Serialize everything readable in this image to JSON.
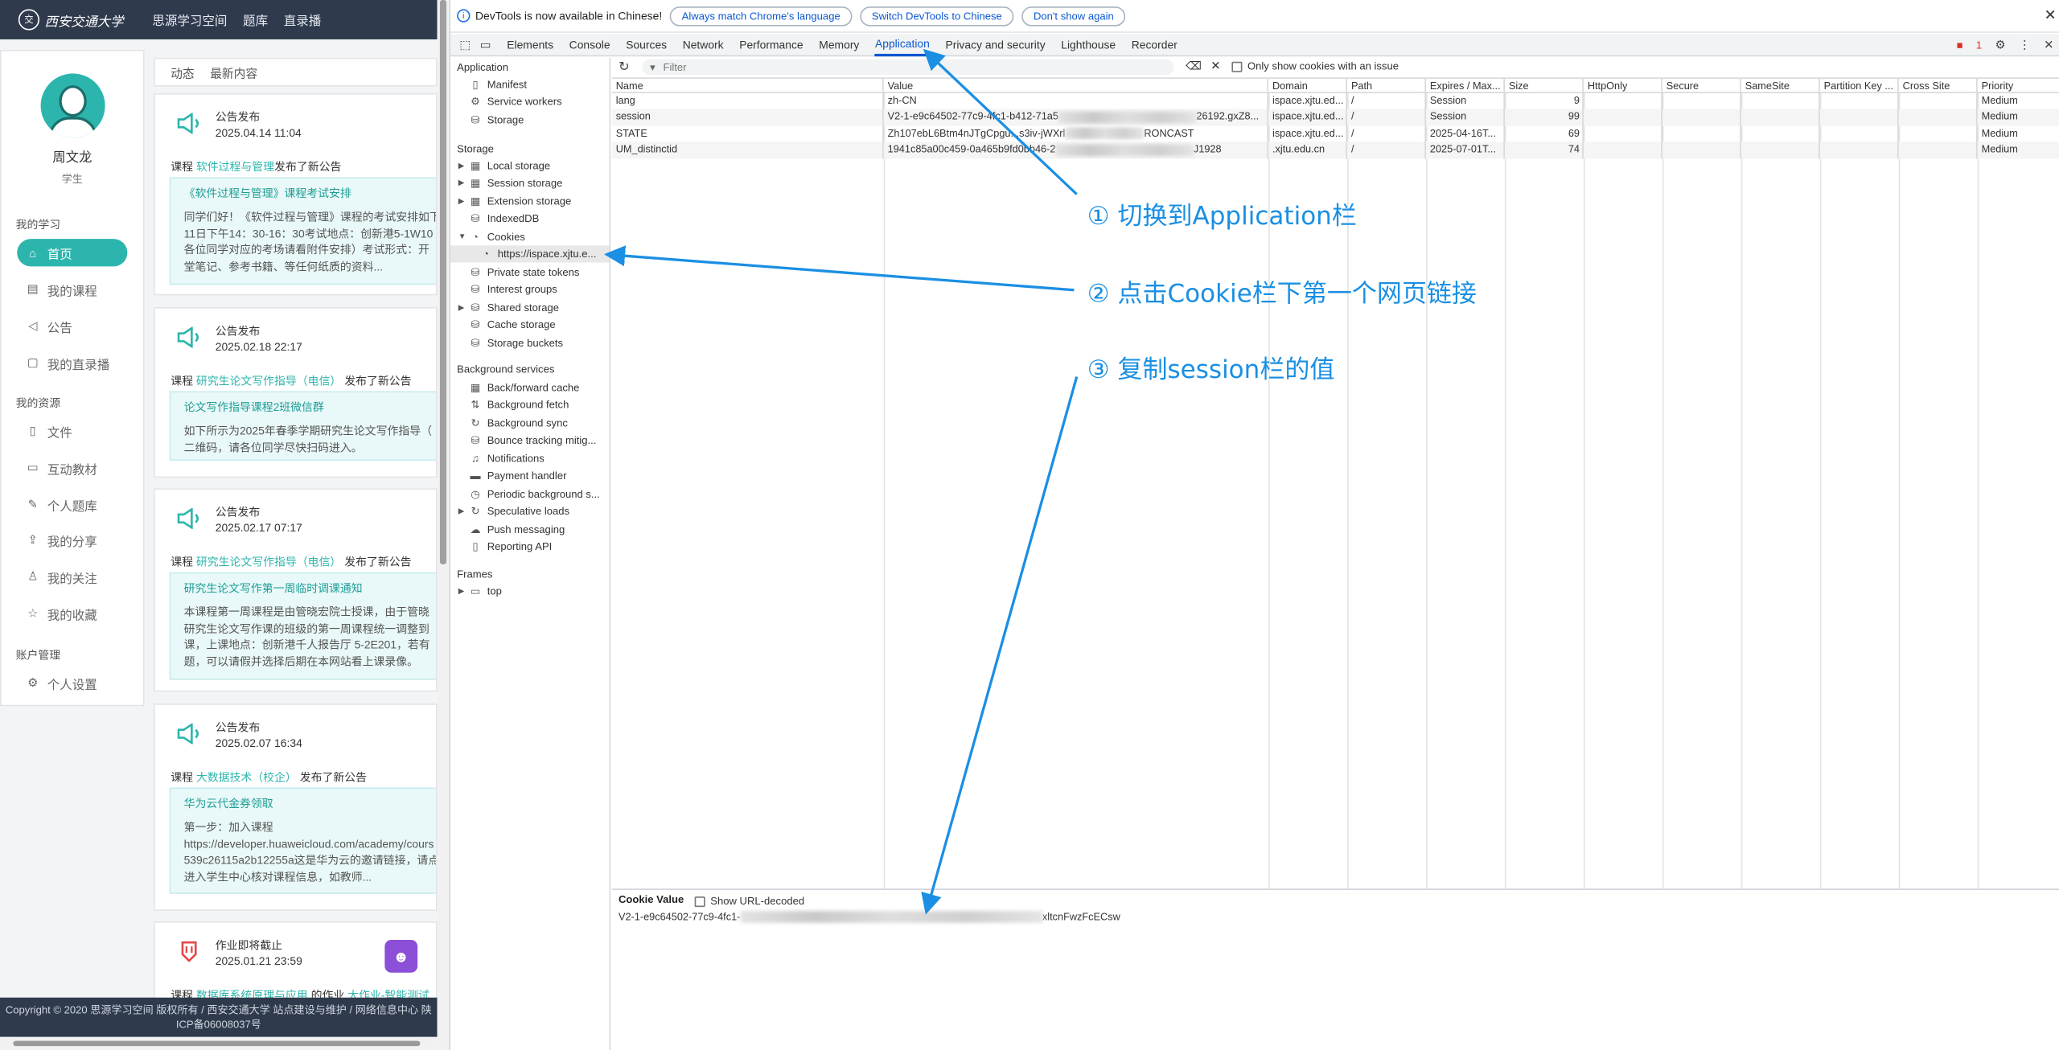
{
  "site": {
    "logo_glyph": "交",
    "logo_text": "西安交通大学",
    "nav": [
      "思源学习空间",
      "题库",
      "直录播"
    ],
    "user": {
      "name": "周文龙",
      "role": "学生"
    },
    "sections": {
      "study": "我的学习",
      "resources": "我的资源",
      "account": "账户管理"
    },
    "menu": [
      {
        "label": "首页",
        "icon": "home-icon",
        "glyph": "⌂",
        "active": true
      },
      {
        "label": "我的课程",
        "icon": "course-icon",
        "glyph": "▤"
      },
      {
        "label": "公告",
        "icon": "announcement-icon",
        "glyph": "◁"
      },
      {
        "label": "我的直录播",
        "icon": "live-icon",
        "glyph": "▢"
      },
      {
        "label": "文件",
        "icon": "file-icon",
        "glyph": "▯"
      },
      {
        "label": "互动教材",
        "icon": "textbook-icon",
        "glyph": "▭"
      },
      {
        "label": "个人题库",
        "icon": "question-bank-icon",
        "glyph": "✎"
      },
      {
        "label": "我的分享",
        "icon": "share-icon",
        "glyph": "⇪"
      },
      {
        "label": "我的关注",
        "icon": "follow-icon",
        "glyph": "♙"
      },
      {
        "label": "我的收藏",
        "icon": "star-icon",
        "glyph": "☆"
      },
      {
        "label": "个人设置",
        "icon": "settings-icon",
        "glyph": "⚙"
      }
    ],
    "feed_tabs": [
      "动态",
      "最新内容"
    ],
    "cards": [
      {
        "title": "公告发布",
        "date": "2025.04.14 11:04",
        "prefix": "课程",
        "course": "软件过程与管理",
        "suffix": "发布了新公告",
        "box_title": "《软件过程与管理》课程考试安排",
        "box_body": "同学们好！《软件过程与管理》课程的考试安排如下\n11日下午14：30-16：30考试地点：创新港5-1W10\n各位同学对应的考场请看附件安排）考试形式：开\n堂笔记、参考书籍、等任何纸质的资料..."
      },
      {
        "title": "公告发布",
        "date": "2025.02.18 22:17",
        "prefix": "课程",
        "course": "研究生论文写作指导（电信）",
        "suffix": "发布了新公告",
        "box_title": "论文写作指导课程2班微信群",
        "box_body": "如下所示为2025年春季学期研究生论文写作指导（\n二维码，请各位同学尽快扫码进入。"
      },
      {
        "title": "公告发布",
        "date": "2025.02.17 07:17",
        "prefix": "课程",
        "course": "研究生论文写作指导（电信）",
        "suffix": "发布了新公告",
        "box_title": "研究生论文写作第一周临时调课通知",
        "box_body": "本课程第一周课程是由管晓宏院士授课，由于管晓\n研究生论文写作课的班级的第一周课程统一调整到\n课，上课地点：创新港千人报告厅 5-2E201，若有\n题，可以请假并选择后期在本网站看上课录像。"
      },
      {
        "title": "公告发布",
        "date": "2025.02.07 16:34",
        "prefix": "课程",
        "course": "大数据技术（校企）",
        "suffix": "发布了新公告",
        "box_title": "华为云代金券领取",
        "box_body": "第一步：加入课程\nhttps://developer.huaweicloud.com/academy/cours\n539c26115a2b12255a这是华为云的邀请链接，请点\n进入学生中心核对课程信息，如教师..."
      },
      {
        "title": "作业即将截止",
        "date": "2025.01.21 23:59",
        "prefix": "课程",
        "course": "数据库系统原理与应用",
        "suffix": "的作业",
        "extra": "大作业-智能测试"
      }
    ],
    "footer": "Copyright © 2020 思源学习空间 版权所有 / 西安交通大学 站点建设与维护 / 网络信息中心 陕\nICP备06008037号"
  },
  "devtools": {
    "info_text": "DevTools is now available in Chinese!",
    "info_buttons": [
      "Always match Chrome's language",
      "Switch DevTools to Chinese",
      "Don't show again"
    ],
    "tabs": [
      "Elements",
      "Console",
      "Sources",
      "Network",
      "Performance",
      "Memory",
      "Application",
      "Privacy and security",
      "Lighthouse",
      "Recorder"
    ],
    "active_tab": "Application",
    "error_count": "1",
    "nav": {
      "application_header": "Application",
      "application_items": [
        "Manifest",
        "Service workers",
        "Storage"
      ],
      "storage_header": "Storage",
      "storage_items": [
        "Local storage",
        "Session storage",
        "Extension storage",
        "IndexedDB",
        "Cookies",
        "https://ispace.xjtu.e...",
        "Private state tokens",
        "Interest groups",
        "Shared storage",
        "Cache storage",
        "Storage buckets"
      ],
      "bg_header": "Background services",
      "bg_items": [
        "Back/forward cache",
        "Background fetch",
        "Background sync",
        "Bounce tracking mitig...",
        "Notifications",
        "Payment handler",
        "Periodic background s...",
        "Speculative loads",
        "Push messaging",
        "Reporting API"
      ],
      "frames_header": "Frames",
      "frames_items": [
        "top"
      ]
    },
    "filter_placeholder": "Filter",
    "only_issue_label": "Only show cookies with an issue",
    "columns": [
      "Name",
      "Value",
      "Domain",
      "Path",
      "Expires / Max...",
      "Size",
      "HttpOnly",
      "Secure",
      "SameSite",
      "Partition Key ...",
      "Cross Site",
      "Priority"
    ],
    "cookies": [
      {
        "name": "lang",
        "value_a": "zh-CN",
        "value_b": "",
        "domain": "ispace.xjtu.ed...",
        "path": "/",
        "expires": "Session",
        "size": "9",
        "priority": "Medium"
      },
      {
        "name": "session",
        "value_a": "V2-1-e9c64502-77c9-4fc1-b412-71a5",
        "value_b": "26192.gxZ8...",
        "domain": "ispace.xjtu.ed...",
        "path": "/",
        "expires": "Session",
        "size": "99",
        "priority": "Medium"
      },
      {
        "name": "STATE",
        "value_a": "Zh107ebL6Btm4nJTgCpgu...s3iv-jWXrl",
        "value_b": "RONCAST",
        "domain": "ispace.xjtu.ed...",
        "path": "/",
        "expires": "2025-04-16T...",
        "size": "69",
        "priority": "Medium"
      },
      {
        "name": "UM_distinctid",
        "value_a": "1941c85a00c459-0a465b9fd0bb46-2",
        "value_b": "J1928",
        "domain": ".xjtu.edu.cn",
        "path": "/",
        "expires": "2025-07-01T...",
        "size": "74",
        "priority": "Medium"
      }
    ],
    "cookie_value_label": "Cookie Value",
    "show_decoded_label": "Show URL-decoded",
    "cookie_value_start": "V2-1-e9c64502-77c9-4fc1-",
    "cookie_value_end": "xltcnFwzFcECsw"
  },
  "annotations": {
    "step1": "① 切换到Application栏",
    "step2": "② 点击Cookie栏下第一个网页链接",
    "step3": "③ 复制session栏的值",
    "color": "#1a8fe3"
  }
}
